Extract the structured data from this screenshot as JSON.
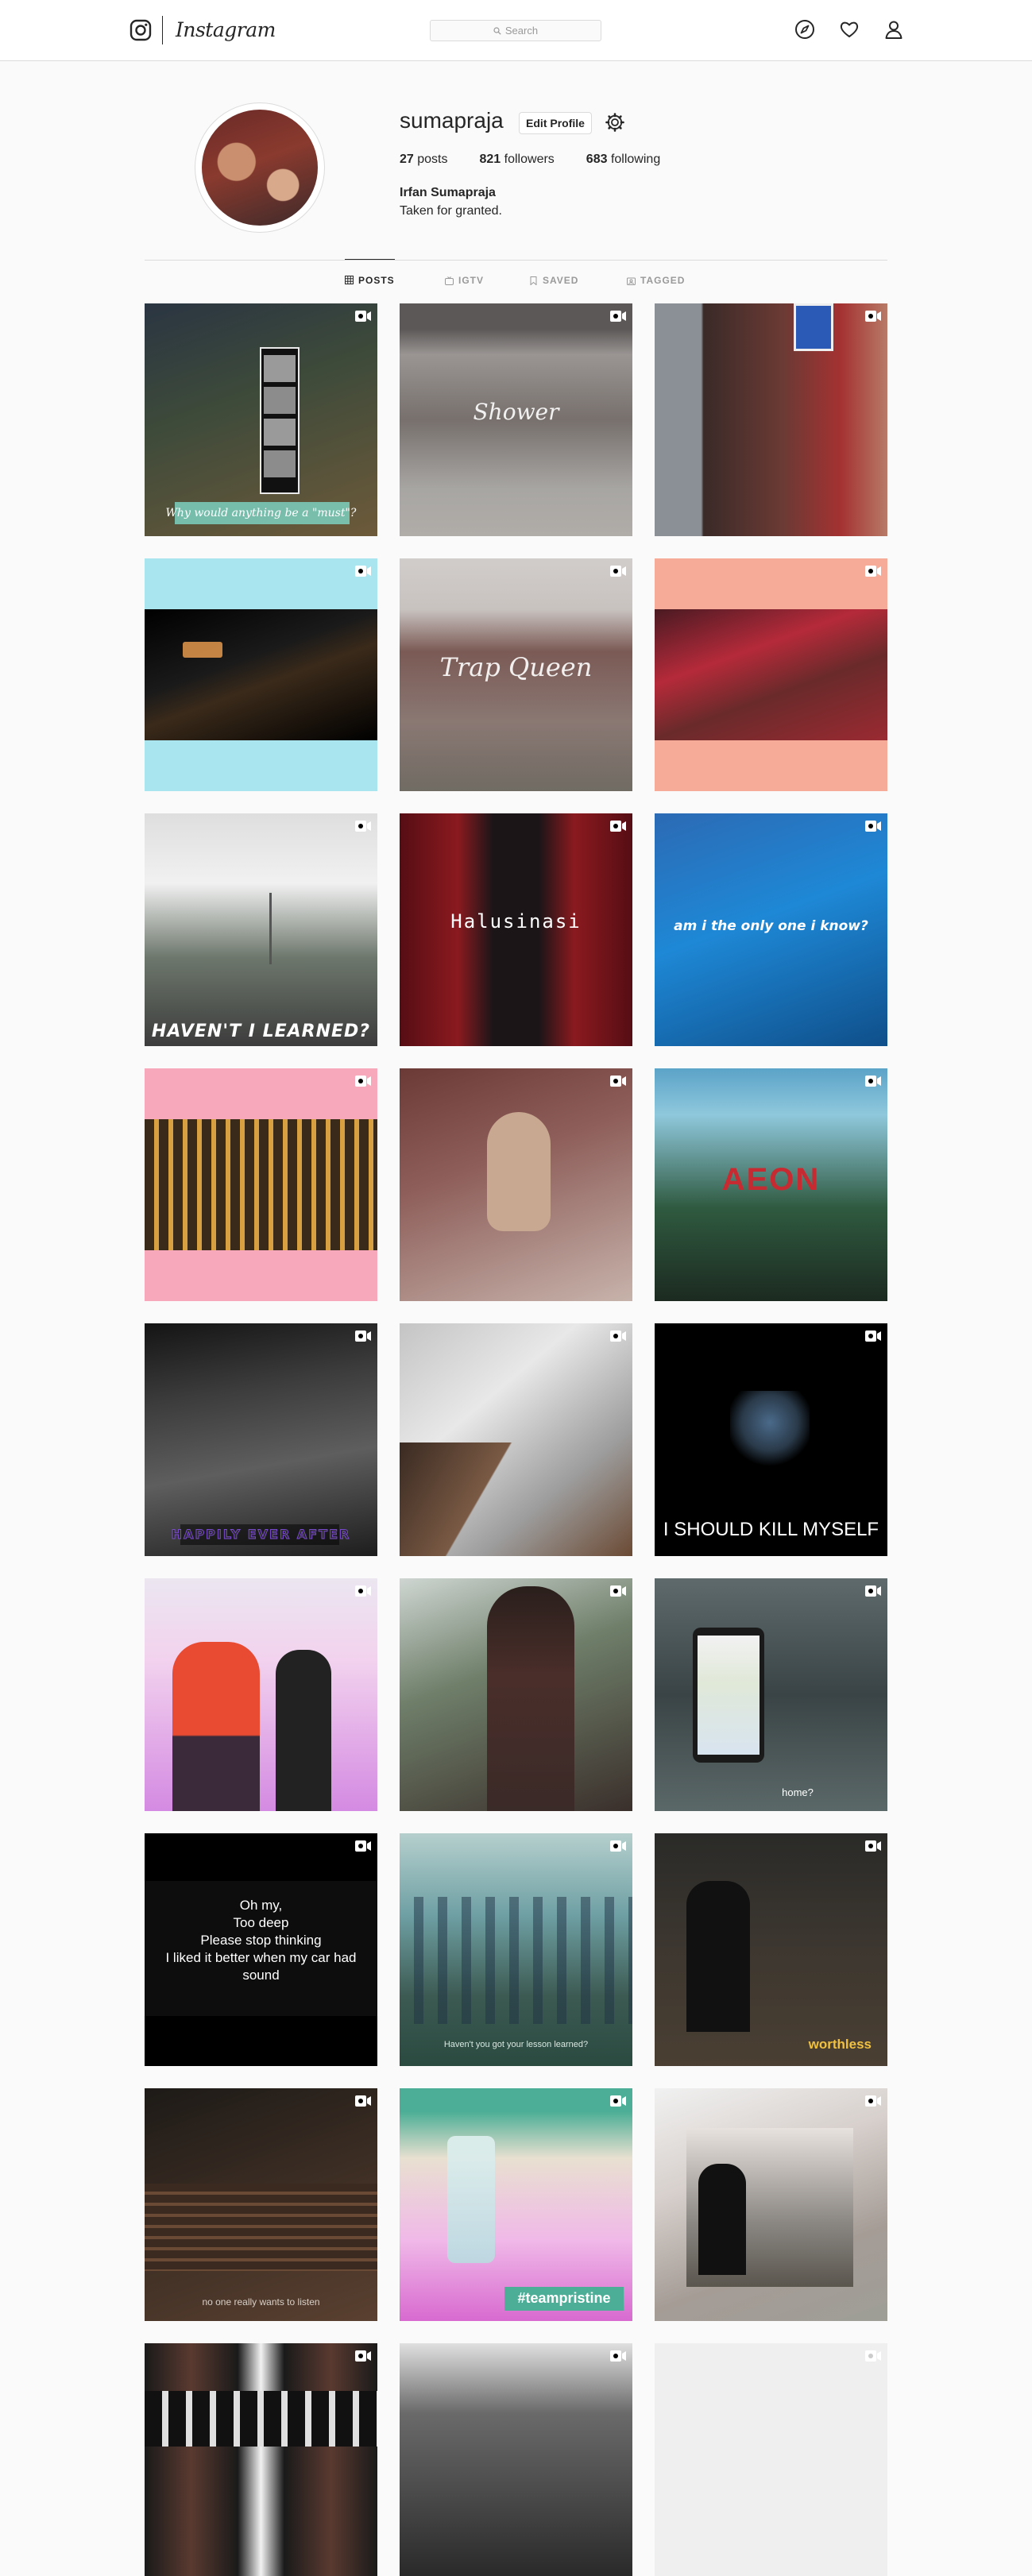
{
  "nav": {
    "logo_text": "Instagram",
    "search_placeholder": "Search",
    "icons": [
      "instagram-logo-icon",
      "compass-icon",
      "heart-icon",
      "user-icon"
    ]
  },
  "profile": {
    "username": "sumapraja",
    "edit_button": "Edit Profile",
    "stats": [
      {
        "count": "27",
        "label": "posts"
      },
      {
        "count": "821",
        "label": "followers"
      },
      {
        "count": "683",
        "label": "following"
      }
    ],
    "full_name": "Irfan Sumapraja",
    "bio": "Taken for granted."
  },
  "tabs": [
    {
      "label": "POSTS",
      "icon": "grid-icon",
      "active": true
    },
    {
      "label": "IGTV",
      "icon": "igtv-icon",
      "active": false
    },
    {
      "label": "SAVED",
      "icon": "bookmark-icon",
      "active": false
    },
    {
      "label": "TAGGED",
      "icon": "tag-icon",
      "active": false
    }
  ],
  "posts": [
    {
      "caption": "Why would anything be a \"must\"?",
      "video": true
    },
    {
      "caption": "Shower",
      "video": true
    },
    {
      "caption": "",
      "video": true
    },
    {
      "caption": "",
      "video": true
    },
    {
      "caption": "Trap Queen",
      "video": true
    },
    {
      "caption": "",
      "video": true
    },
    {
      "caption": "HAVEN'T I LEARNED?",
      "video": true
    },
    {
      "caption": "Halusinasi",
      "video": true
    },
    {
      "caption": "am i the only one i know?",
      "video": true
    },
    {
      "caption": "",
      "video": true
    },
    {
      "caption": "",
      "video": true
    },
    {
      "caption": "AEON",
      "video": true
    },
    {
      "caption": "HAPPILY EVER AFTER",
      "video": true
    },
    {
      "caption": "",
      "video": true
    },
    {
      "caption": "I SHOULD KILL MYSELF",
      "video": true
    },
    {
      "caption": "",
      "video": true
    },
    {
      "caption": "",
      "video": true
    },
    {
      "caption": "home?",
      "video": true
    },
    {
      "caption": "Oh my,\nToo deep\nPlease stop thinking\nI liked it better when my car had sound",
      "video": true
    },
    {
      "caption": "Haven't you got your lesson learned?",
      "video": true
    },
    {
      "caption": "worthless",
      "video": true
    },
    {
      "caption": "no one really wants to listen",
      "video": true
    },
    {
      "caption": "#teampristine",
      "video": true
    },
    {
      "caption": "",
      "video": true
    },
    {
      "caption": "",
      "video": true
    },
    {
      "caption": "",
      "video": true
    },
    {
      "caption": "",
      "video": true
    }
  ]
}
